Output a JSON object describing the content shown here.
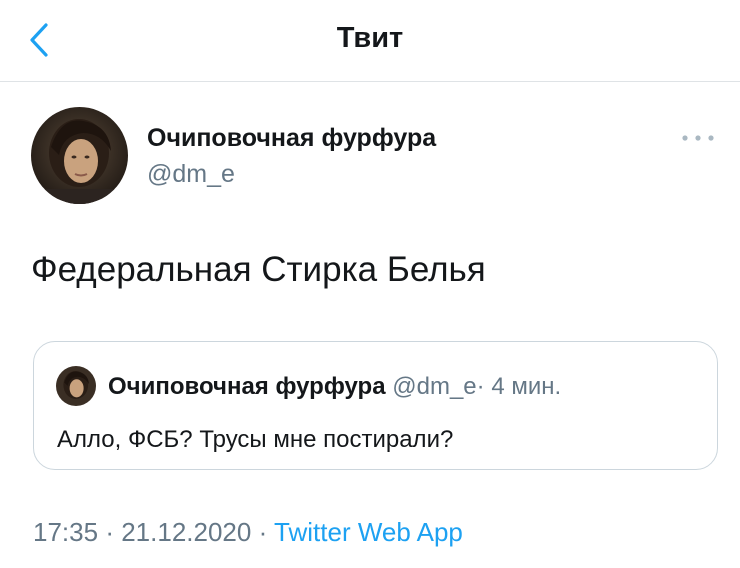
{
  "header": {
    "title": "Твит",
    "back_icon": "chevron-left-icon",
    "accent_color": "#1da1f2"
  },
  "tweet": {
    "author_name": "Очиповочная фурфура",
    "author_handle": "@dm_e",
    "more_icon": "more-options-icon",
    "text": "Федеральная Стирка Белья",
    "time": "17:35",
    "separator": "·",
    "date": "21.12.2020",
    "source": "Twitter Web App"
  },
  "quoted_tweet": {
    "author_name": "Очиповочная фурфура",
    "author_handle": "@dm_e",
    "separator": "·",
    "time_ago": "4 мин.",
    "text": "Алло, ФСБ? Трусы мне постирали?"
  },
  "colors": {
    "text_primary": "#14171a",
    "text_secondary": "#657786",
    "link": "#1da1f2",
    "divider": "#dfe3e6"
  }
}
